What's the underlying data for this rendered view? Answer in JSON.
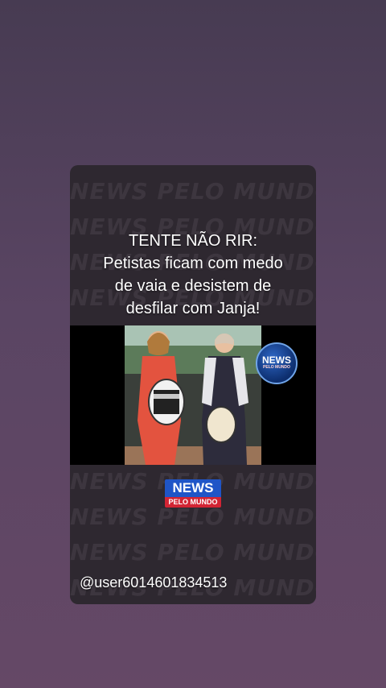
{
  "post": {
    "watermark_text": "NEWS PELO MUNDO",
    "headline_line1": "TENTE NÃO RIR:",
    "headline_line2": "Petistas ficam com medo",
    "headline_line3": "de vaia e desistem de",
    "headline_line4": "desfilar com Janja!",
    "image_badge_title": "NEWS",
    "image_badge_sub": "PELO MUNDO",
    "logo_title": "NEWS",
    "logo_sub": "PELO MUNDO",
    "username": "@user6014601834513"
  }
}
